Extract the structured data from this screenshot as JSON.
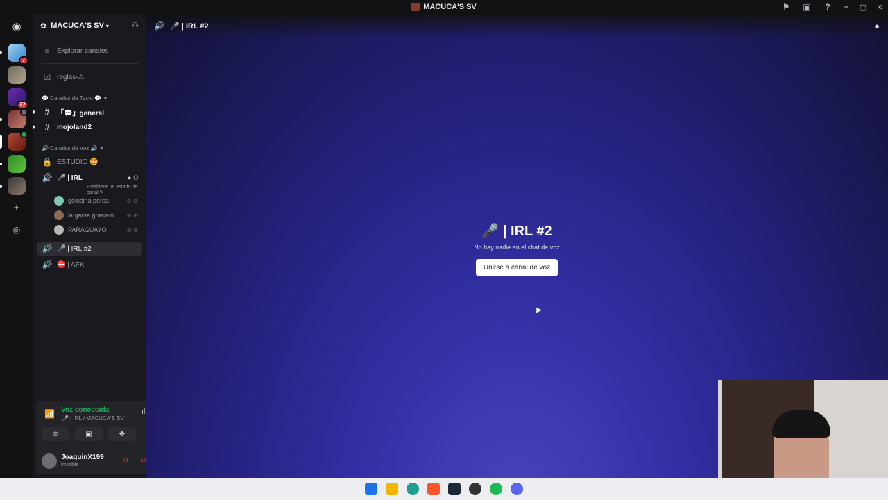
{
  "window": {
    "title": "MACUCA'S SV"
  },
  "servers": [
    {
      "name": "server-1",
      "badge": "7"
    },
    {
      "name": "server-2"
    },
    {
      "name": "server-3",
      "badge": "22"
    },
    {
      "name": "server-4"
    },
    {
      "name": "server-5-current"
    },
    {
      "name": "server-6"
    },
    {
      "name": "server-7"
    }
  ],
  "guild": {
    "name": "MACUCA'S SV"
  },
  "sidebar": {
    "explore": "Explorar canales",
    "rules": "reglas-⚠",
    "text_category": "💬 Canales de Texto 💬",
    "text_channels": [
      "「💬」general",
      "mojoland2"
    ],
    "voice_category": "🔊 Canales de Voz 🔊",
    "studio": "ESTUDIO 🤩",
    "irl": "🎤 | IRL",
    "irl_status": "Establece un estado de canal ✎",
    "users": [
      "golosina perea",
      "la garsa grasiani",
      "PARAGUAYO"
    ],
    "irl2": "🎤 | IRL #2",
    "afk": "⛔ | AFK"
  },
  "voice_panel": {
    "title": "Voz conectada",
    "subtitle": "🎤 | IRL / MACUCA'S SV"
  },
  "user_panel": {
    "name": "JoaquinX199",
    "status": "Invisible"
  },
  "main": {
    "header": "🎤 | IRL #2",
    "title": "🎤 | IRL #2",
    "subtitle": "No hay nadie en el chat de voz",
    "join_label": "Unirse a canal de voz"
  },
  "colors": {
    "accent_green": "#23a55a",
    "danger": "#da373c",
    "gradient_bottom": "#4a45c0"
  }
}
